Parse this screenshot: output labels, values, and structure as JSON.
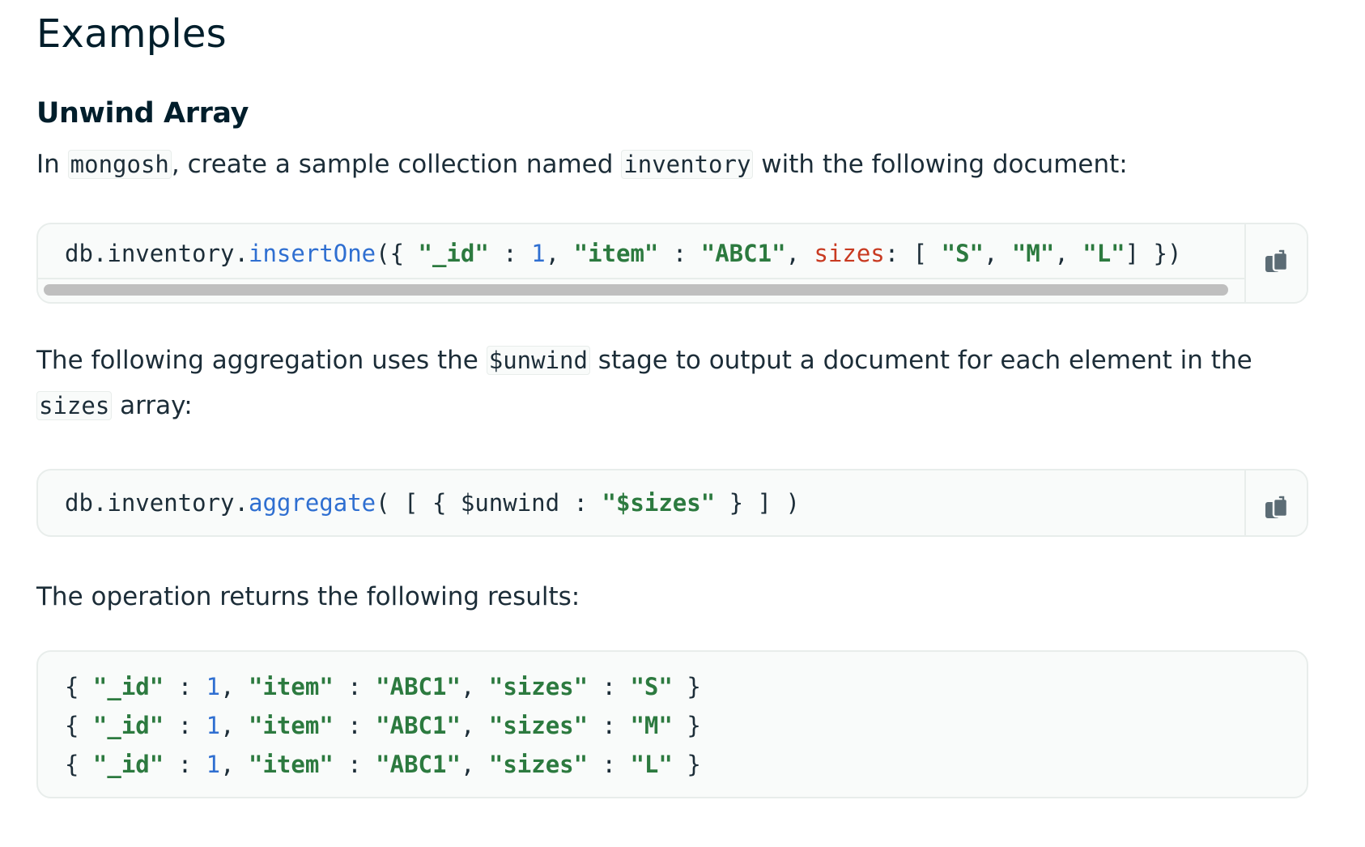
{
  "heading": "Examples",
  "subheading": "Unwind Array",
  "intro": {
    "prefix": "In ",
    "shell": "mongosh",
    "middle": ", create a sample collection named ",
    "collection": "inventory",
    "suffix": " with the following document:"
  },
  "code1": {
    "receiver": "db.inventory.",
    "method": "insertOne",
    "open": "({ ",
    "id_key": "\"_id\"",
    "sep1": " : ",
    "id_val": "1",
    "comma1": ", ",
    "item_key": "\"item\"",
    "sep2": " : ",
    "item_val": "\"ABC1\"",
    "comma2": ", ",
    "sizes_key": "sizes",
    "colon": ": [ ",
    "s": "\"S\"",
    "c3": ", ",
    "m": "\"M\"",
    "c4": ", ",
    "l": "\"L\"",
    "close": "] })"
  },
  "para2": {
    "prefix": "The following aggregation uses the ",
    "stage": "$unwind",
    "middle": " stage to output a document for each element in the",
    "field": "sizes",
    "suffix": " array:"
  },
  "code2": {
    "receiver": "db.inventory.",
    "method": "aggregate",
    "open": "( [ { $unwind : ",
    "path": "\"$sizes\"",
    "close": " } ] )"
  },
  "para3": "The operation returns the following results:",
  "results": [
    {
      "open": "{ ",
      "id_key": "\"_id\"",
      "s1": " : ",
      "id_val": "1",
      "c1": ", ",
      "item_key": "\"item\"",
      "s2": " : ",
      "item_val": "\"ABC1\"",
      "c2": ", ",
      "sizes_key": "\"sizes\"",
      "s3": " : ",
      "size_val": "\"S\"",
      "close": " }"
    },
    {
      "open": "{ ",
      "id_key": "\"_id\"",
      "s1": " : ",
      "id_val": "1",
      "c1": ", ",
      "item_key": "\"item\"",
      "s2": " : ",
      "item_val": "\"ABC1\"",
      "c2": ", ",
      "sizes_key": "\"sizes\"",
      "s3": " : ",
      "size_val": "\"M\"",
      "close": " }"
    },
    {
      "open": "{ ",
      "id_key": "\"_id\"",
      "s1": " : ",
      "id_val": "1",
      "c1": ", ",
      "item_key": "\"item\"",
      "s2": " : ",
      "item_val": "\"ABC1\"",
      "c2": ", ",
      "sizes_key": "\"sizes\"",
      "s3": " : ",
      "size_val": "\"L\"",
      "close": " }"
    }
  ],
  "icons": {
    "copy": "copy-icon"
  },
  "colors": {
    "string": "#2c7a3f",
    "function": "#2f6fd1",
    "number": "#2f6fd1",
    "key": "#c83a21",
    "code_bg": "#f9fbfa",
    "border": "#e8edeb"
  }
}
